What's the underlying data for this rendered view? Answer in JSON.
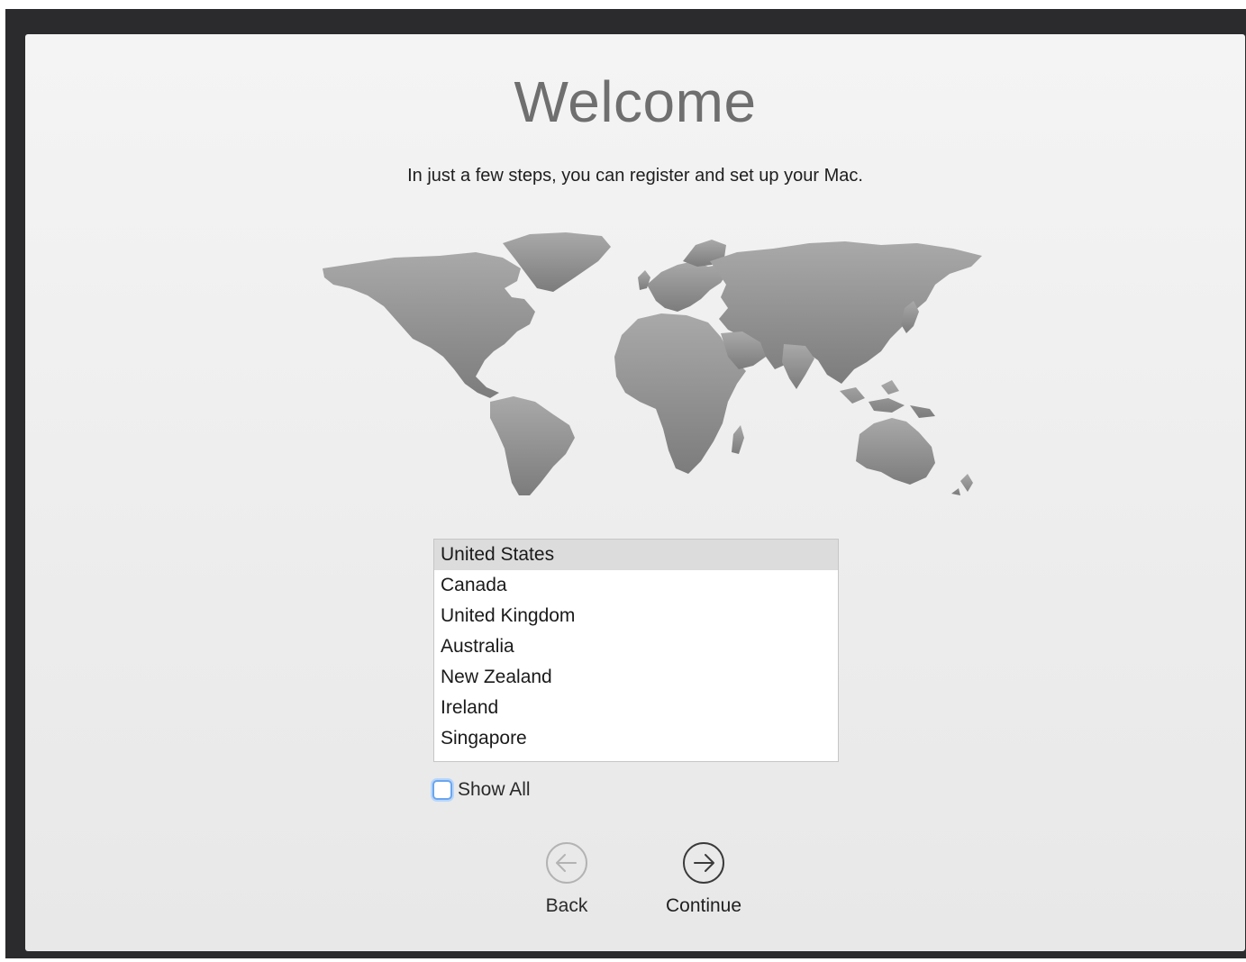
{
  "title": "Welcome",
  "subtitle": "In just a few steps, you can register and set up your Mac.",
  "countries": [
    "United States",
    "Canada",
    "United Kingdom",
    "Australia",
    "New Zealand",
    "Ireland",
    "Singapore"
  ],
  "selected_country": "United States",
  "show_all": {
    "label": "Show All",
    "checked": false
  },
  "back_button": {
    "label": "Back",
    "icon": "arrow-left-circle-icon",
    "enabled": false
  },
  "continue_button": {
    "label": "Continue",
    "icon": "arrow-right-circle-icon",
    "enabled": true
  },
  "colors": {
    "accent": "#6aa6ef",
    "selection": "#dcdcdc",
    "map": "#8a8a8a"
  }
}
